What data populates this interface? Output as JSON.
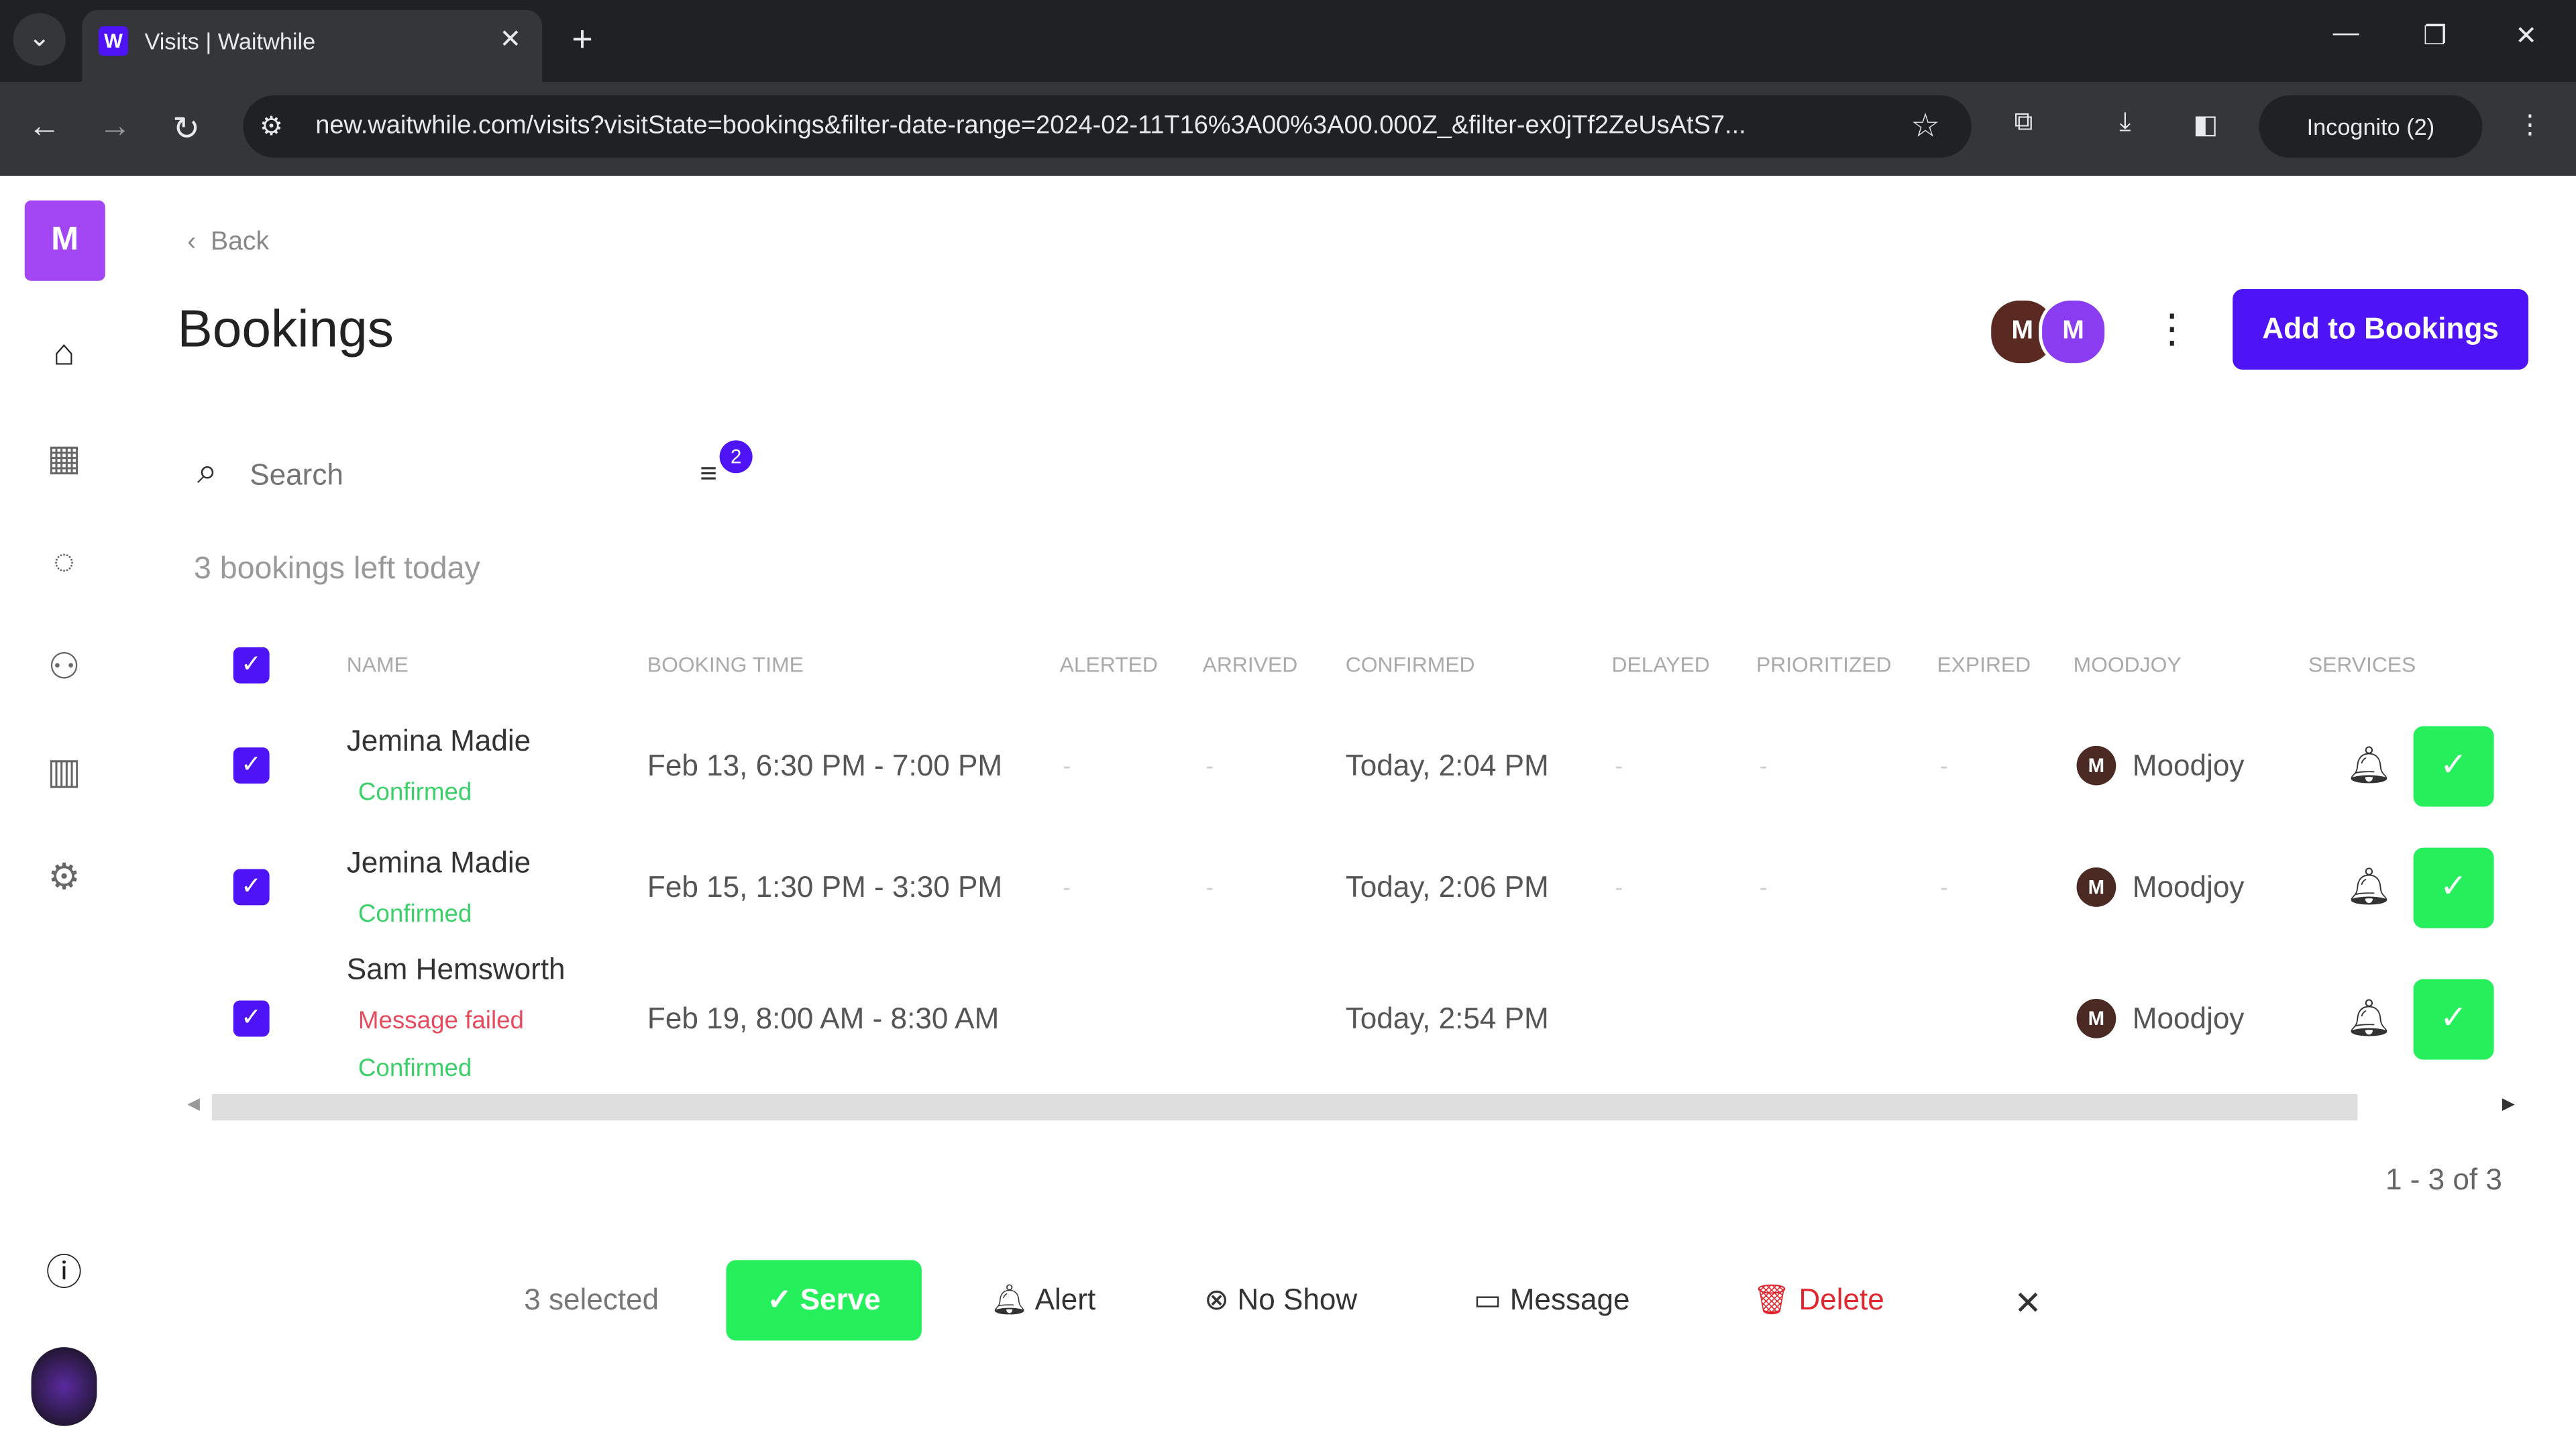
{
  "browser": {
    "tab_title": "Visits | Waitwhile",
    "url": "new.waitwhile.com/visits?visitState=bookings&filter-date-range=2024-02-11T16%3A00%3A00.000Z_&filter-ex0jTf2ZeUsAtS7...",
    "incognito": "Incognito (2)"
  },
  "sidebar": {
    "logo": "M",
    "items": [
      "home",
      "calendar",
      "messages",
      "customers",
      "analytics",
      "settings"
    ],
    "help": "help",
    "avatar": "user"
  },
  "header": {
    "back": "Back",
    "title": "Bookings",
    "avatars": [
      "M",
      "M"
    ],
    "add_button": "Add to Bookings"
  },
  "search": {
    "placeholder": "Search",
    "filter_count": "2"
  },
  "summary": "3 bookings left today",
  "columns": [
    "NAME",
    "BOOKING TIME",
    "ALERTED",
    "ARRIVED",
    "CONFIRMED",
    "DELAYED",
    "PRIORITIZED",
    "EXPIRED",
    "MOODJOY",
    "SERVICES"
  ],
  "rows": [
    {
      "name": "Jemina Madie",
      "statuses": [
        "Confirmed"
      ],
      "booking_time": "Feb 13, 6:30 PM - 7:00 PM",
      "alerted": "-",
      "arrived": "-",
      "confirmed": "Today, 2:04 PM",
      "delayed": "-",
      "prioritized": "-",
      "expired": "-",
      "resource_initial": "M",
      "resource": "Moodjoy",
      "checked": true
    },
    {
      "name": "Jemina Madie",
      "statuses": [
        "Confirmed"
      ],
      "booking_time": "Feb 15, 1:30 PM - 3:30 PM",
      "alerted": "-",
      "arrived": "-",
      "confirmed": "Today, 2:06 PM",
      "delayed": "-",
      "prioritized": "-",
      "expired": "-",
      "resource_initial": "M",
      "resource": "Moodjoy",
      "checked": true
    },
    {
      "name": "Sam Hemsworth",
      "statuses": [
        "Message failed",
        "Confirmed"
      ],
      "booking_time": "Feb 19, 8:00 AM - 8:30 AM",
      "alerted": "-",
      "arrived": "-",
      "confirmed": "Today, 2:54 PM",
      "delayed": "-",
      "prioritized": "-",
      "expired": "-",
      "resource_initial": "M",
      "resource": "Moodjoy",
      "checked": true
    }
  ],
  "pagination": "1 - 3 of 3",
  "actionbar": {
    "selected": "3 selected",
    "serve": "Serve",
    "alert": "Alert",
    "no_show": "No Show",
    "message": "Message",
    "delete": "Delete"
  },
  "colors": {
    "brand": "#4f14f5",
    "serve": "#25ef5a",
    "delete": "#e0262f",
    "confirmed": "#3ccf6a",
    "failed": "#e74c5e"
  }
}
